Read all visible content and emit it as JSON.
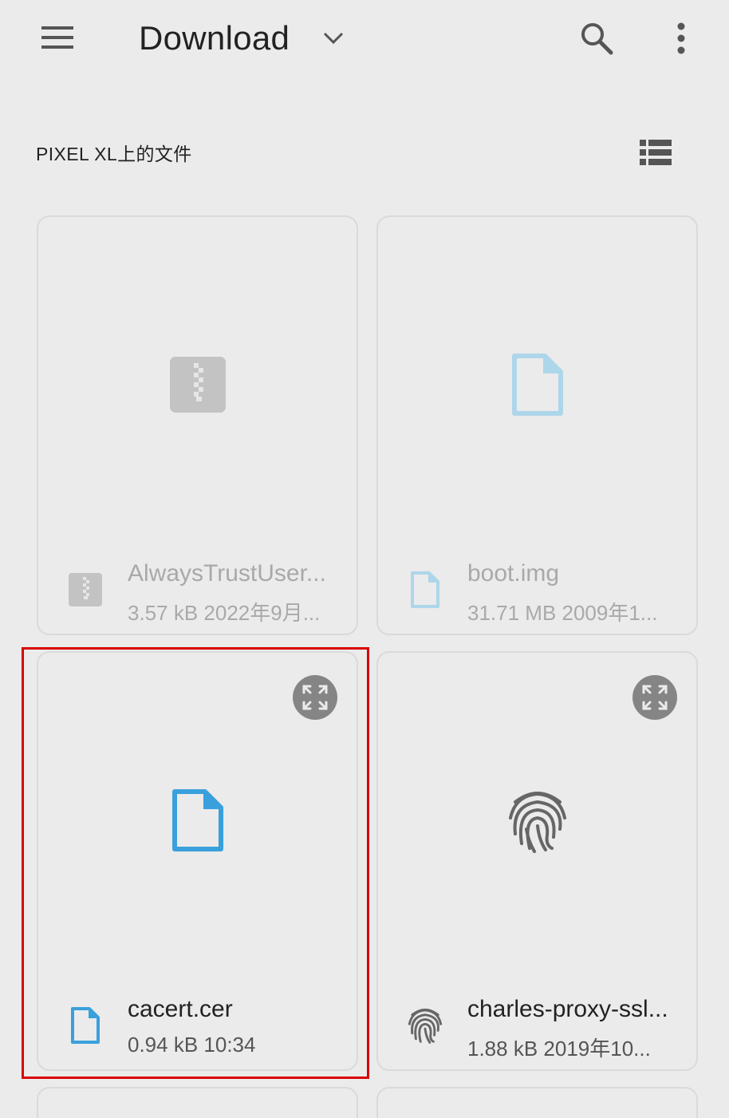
{
  "toolbar": {
    "title": "Download",
    "menu_icon": "menu-icon",
    "dropdown_icon": "chevron-down-icon",
    "search_icon": "search-icon",
    "more_icon": "more-vert-icon"
  },
  "section": {
    "title": "PIXEL XL上的文件",
    "view_toggle_icon": "list-view-icon"
  },
  "files": [
    {
      "name": "AlwaysTrustUser...",
      "detail": "3.57 kB 2022年9月...",
      "icon": "archive-icon",
      "dimmed": true,
      "expand": false
    },
    {
      "name": "boot.img",
      "detail": "31.71 MB 2009年1...",
      "icon": "document-icon",
      "dimmed": true,
      "expand": false
    },
    {
      "name": "cacert.cer",
      "detail": "0.94 kB 10:34",
      "icon": "document-icon",
      "dimmed": false,
      "expand": true,
      "highlighted": true
    },
    {
      "name": "charles-proxy-ssl...",
      "detail": "1.88 kB 2019年10...",
      "icon": "fingerprint-icon",
      "dimmed": false,
      "expand": true
    }
  ],
  "colors": {
    "background": "#ebebeb",
    "accent_blue": "#3aa0dc",
    "dim_blue": "#aed6ea",
    "highlight": "#d90000"
  }
}
